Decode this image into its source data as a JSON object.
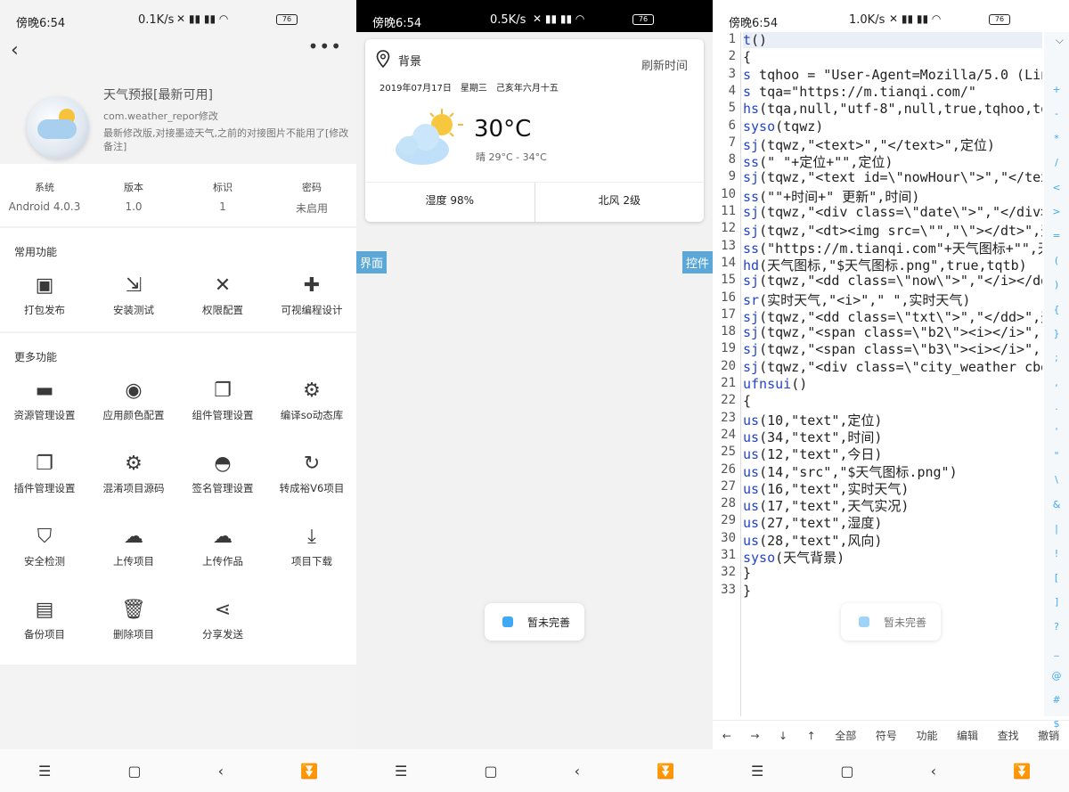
{
  "status_left": {
    "time": "傍晚6:54",
    "speed": "0.1K/s",
    "battery": "76"
  },
  "status_mid": {
    "time": "傍晚6:54",
    "speed": "0.5K/s",
    "battery": "76"
  },
  "status_right": {
    "time": "傍晚6:54",
    "speed": "1.0K/s",
    "battery": "76"
  },
  "app": {
    "name": "天气预报[最新可用]",
    "package": "com.weather_repor修改",
    "description": "最新修改版,对接墨迹天气,之前的对接图片不能用了[修改备注]"
  },
  "info": [
    {
      "key": "系统",
      "value": "Android 4.0.3"
    },
    {
      "key": "版本",
      "value": "1.0"
    },
    {
      "key": "标识",
      "value": "1"
    },
    {
      "key": "密码",
      "value": "未启用"
    }
  ],
  "common_section": {
    "title": "常用功能",
    "items": [
      {
        "label": "打包发布",
        "icon": "package-publish-icon",
        "glyph": "▣"
      },
      {
        "label": "安装测试",
        "icon": "install-test-icon",
        "glyph": "⇲"
      },
      {
        "label": "权限配置",
        "icon": "tools-icon",
        "glyph": "✕"
      },
      {
        "label": "可视编程设计",
        "icon": "puzzle-icon",
        "glyph": "✚"
      }
    ]
  },
  "more_section": {
    "title": "更多功能",
    "items": [
      {
        "label": "资源管理设置",
        "icon": "folder-icon",
        "glyph": "▬"
      },
      {
        "label": "应用颜色配置",
        "icon": "palette-icon",
        "glyph": "◉"
      },
      {
        "label": "组件管理设置",
        "icon": "layers-icon",
        "glyph": "❐"
      },
      {
        "label": "编译so动态库",
        "icon": "gears-icon",
        "glyph": "⚙"
      },
      {
        "label": "插件管理设置",
        "icon": "plugins-icon",
        "glyph": "❐"
      },
      {
        "label": "混淆项目源码",
        "icon": "gear-icon",
        "glyph": "⚙"
      },
      {
        "label": "签名管理设置",
        "icon": "android-icon",
        "glyph": "◓"
      },
      {
        "label": "转成裕V6项目",
        "icon": "refresh-icon",
        "glyph": "↻"
      },
      {
        "label": "安全检测",
        "icon": "shield-icon",
        "glyph": "⛉"
      },
      {
        "label": "上传项目",
        "icon": "cloud-upload-icon",
        "glyph": "☁"
      },
      {
        "label": "上传作品",
        "icon": "cloud-upload-icon",
        "glyph": "☁"
      },
      {
        "label": "项目下载",
        "icon": "download-icon",
        "glyph": "⤓"
      },
      {
        "label": "备份项目",
        "icon": "save-icon",
        "glyph": "▤"
      },
      {
        "label": "删除项目",
        "icon": "trash-icon",
        "glyph": "🗑"
      },
      {
        "label": "分享发送",
        "icon": "share-icon",
        "glyph": "⋖"
      }
    ]
  },
  "weather": {
    "location": "背景",
    "refresh": "刷新时间",
    "date": "2019年07月17日　星期三　己亥年六月十五",
    "temperature": "30°C",
    "condition": "晴 29°C - 34°C",
    "humidity": "湿度 98%",
    "wind": "北风 2级"
  },
  "tags": {
    "left": "界面",
    "right": "控件"
  },
  "toast": "暂未完善",
  "code_lines": [
    "t()",
    "{",
    "s tqhoo = \"User-Agent=Mozilla/5.0 (Lin",
    "s tqa=\"https://m.tianqi.com/\"",
    "hs(tqa,null,\"utf-8\",null,true,tqhoo,tq",
    "syso(tqwz)",
    "sj(tqwz,\"<text>\",\"</text>\",定位)",
    "ss(\" \"+定位+\"\",定位)",
    "sj(tqwz,\"<text id=\\\"nowHour\\\">\",\"</tex",
    "ss(\"\"+时间+\" 更新\",时间)",
    "sj(tqwz,\"<div class=\\\"date\\\">\",\"</div>",
    "sj(tqwz,\"<dt><img src=\\\"\",\"\\\"></dt>\",天",
    "ss(\"https://m.tianqi.com\"+天气图标+\"\",天",
    "hd(天气图标,\"$天气图标.png\",true,tqtb)",
    "sj(tqwz,\"<dd class=\\\"now\\\">\",\"</i></dd",
    "sr(实时天气,\"<i>\",\" \",实时天气)",
    "sj(tqwz,\"<dd class=\\\"txt\\\">\",\"</dd>\",天",
    "sj(tqwz,\"<span class=\\\"b2\\\"><i></i>\",\"",
    "sj(tqwz,\"<span class=\\\"b3\\\"><i></i>\",\"",
    "sj(tqwz,\"<div class=\\\"city_weather cbg",
    "ufnsui()",
    "{",
    "us(10,\"text\",定位)",
    "us(34,\"text\",时间)",
    "us(12,\"text\",今日)",
    "us(14,\"src\",\"$天气图标.png\")",
    "us(16,\"text\",实时天气)",
    "us(17,\"text\",天气实况)",
    "us(27,\"text\",湿度)",
    "us(28,\"text\",风向)",
    "syso(天气背景)",
    "}",
    "}"
  ],
  "symbols": [
    "+",
    "-",
    "*",
    "/",
    "<",
    ">",
    "=",
    "(",
    ")",
    "{",
    "}",
    ";",
    ",",
    ".",
    "'",
    "\"",
    "\\",
    "&",
    "|",
    "!",
    "[",
    "]",
    "?",
    "_",
    "@",
    "#",
    "$"
  ],
  "editor_toolbar": [
    "←",
    "→",
    "↓",
    "↑",
    "全部",
    "符号",
    "功能",
    "编辑",
    "查找",
    "撤销"
  ],
  "navbar": {
    "menu": "☰",
    "home": "▢",
    "back": "‹",
    "assist": "⏬"
  }
}
